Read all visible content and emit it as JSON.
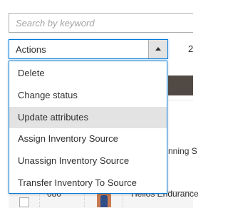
{
  "search": {
    "placeholder": "Search by keyword",
    "value": ""
  },
  "actions": {
    "label": "Actions",
    "open": true,
    "items": [
      {
        "label": "Delete"
      },
      {
        "label": "Change status"
      },
      {
        "label": "Update attributes",
        "highlighted": true
      },
      {
        "label": "Assign Inventory Source"
      },
      {
        "label": "Unassign Inventory Source"
      },
      {
        "label": "Transfer Inventory To Source"
      }
    ]
  },
  "pager": {
    "records_fragment": "2"
  },
  "grid": {
    "partial_text": "nning S",
    "row": {
      "id": "080",
      "name": "Helios Endurance"
    }
  },
  "colors": {
    "focus_border": "#007bdb",
    "header_bg": "#514943",
    "highlight_bg": "#e3e3e3"
  }
}
